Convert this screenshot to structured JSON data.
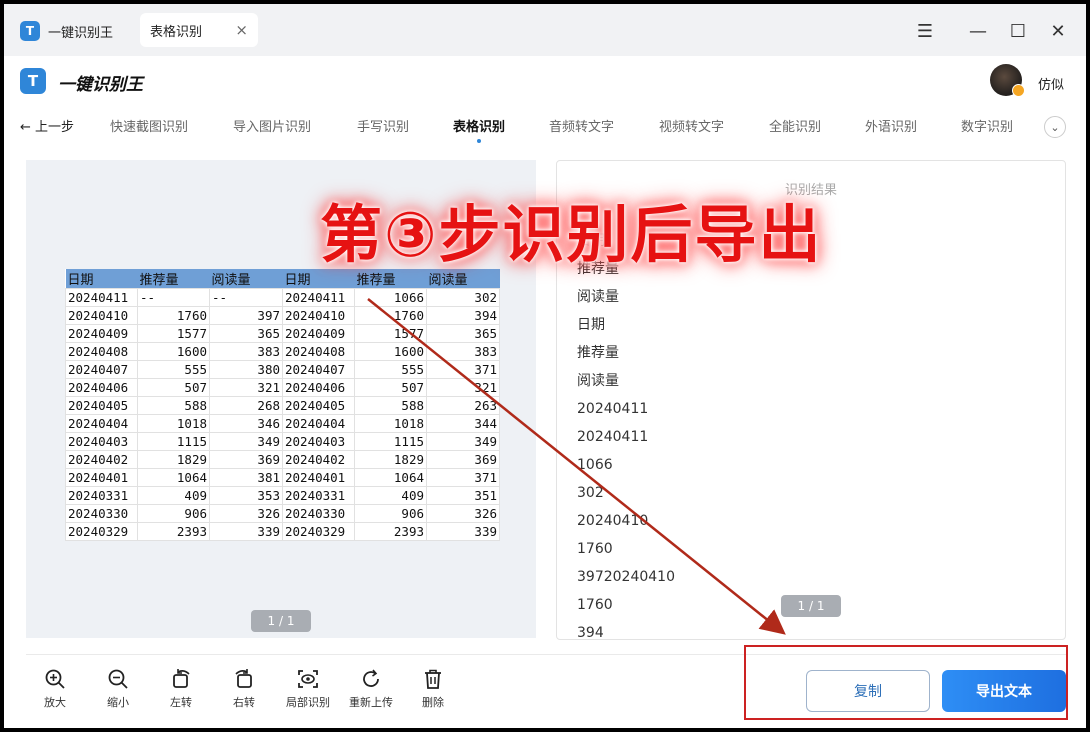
{
  "titlebar": {
    "app_name": "一键识别王",
    "tab_label": "表格识别",
    "tab_close": "×",
    "menu": "☰",
    "minimize": "—",
    "maximize": "☐",
    "close": "✕"
  },
  "header": {
    "logo_glyph": "T",
    "title": "一键识别王",
    "username": "仿似"
  },
  "nav": {
    "back": "← 上一步",
    "items": [
      "快速截图识别",
      "导入图片识别",
      "手写识别",
      "表格识别",
      "音频转文字",
      "视频转文字",
      "全能识别",
      "外语识别",
      "数字识别"
    ],
    "active": "表格识别",
    "more": "⌄"
  },
  "preview": {
    "headers": [
      "日期",
      "推荐量",
      "阅读量",
      "日期",
      "推荐量",
      "阅读量"
    ],
    "rows": [
      [
        "20240411",
        "--",
        "--",
        "20240411",
        "1066",
        "302"
      ],
      [
        "20240410",
        "1760",
        "397",
        "20240410",
        "1760",
        "394"
      ],
      [
        "20240409",
        "1577",
        "365",
        "20240409",
        "1577",
        "365"
      ],
      [
        "20240408",
        "1600",
        "383",
        "20240408",
        "1600",
        "383"
      ],
      [
        "20240407",
        "555",
        "380",
        "20240407",
        "555",
        "371"
      ],
      [
        "20240406",
        "507",
        "321",
        "20240406",
        "507",
        "321"
      ],
      [
        "20240405",
        "588",
        "268",
        "20240405",
        "588",
        "263"
      ],
      [
        "20240404",
        "1018",
        "346",
        "20240404",
        "1018",
        "344"
      ],
      [
        "20240403",
        "1115",
        "349",
        "20240403",
        "1115",
        "349"
      ],
      [
        "20240402",
        "1829",
        "369",
        "20240402",
        "1829",
        "369"
      ],
      [
        "20240401",
        "1064",
        "381",
        "20240401",
        "1064",
        "371"
      ],
      [
        "20240331",
        "409",
        "353",
        "20240331",
        "409",
        "351"
      ],
      [
        "20240330",
        "906",
        "326",
        "20240330",
        "906",
        "326"
      ],
      [
        "20240329",
        "2393",
        "339",
        "20240329",
        "2393",
        "339"
      ]
    ],
    "page_indicator": "1 / 1"
  },
  "result": {
    "title": "识别结果",
    "items": [
      "日期",
      "推荐量",
      "阅读量",
      "日期",
      "推荐量",
      "阅读量",
      "20240411",
      "20240411",
      "1066",
      "302",
      "20240410",
      "1760",
      "39720240410",
      "1760",
      "394"
    ],
    "page_indicator": "1 / 1"
  },
  "annotation": {
    "text": "第③步识别后导出"
  },
  "toolbar": {
    "tools": [
      {
        "id": "zoom-in",
        "label": "放大"
      },
      {
        "id": "zoom-out",
        "label": "缩小"
      },
      {
        "id": "rotate-left",
        "label": "左转"
      },
      {
        "id": "rotate-right",
        "label": "右转"
      },
      {
        "id": "partial-recognize",
        "label": "局部识别"
      },
      {
        "id": "reupload",
        "label": "重新上传"
      },
      {
        "id": "delete",
        "label": "删除"
      }
    ],
    "copy_label": "复制",
    "export_label": "导出文本"
  },
  "colors": {
    "accent": "#2f86d8",
    "export_button": "#1e6fe0",
    "header_fill": "#6f9fd6",
    "annotation_red": "#e61212",
    "arrow": "#b02a1a"
  }
}
